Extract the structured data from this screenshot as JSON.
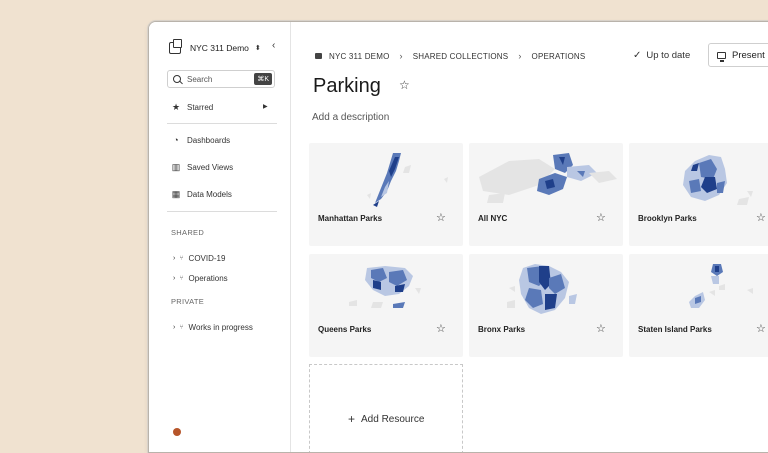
{
  "workspace": {
    "name": "NYC 311 Demo"
  },
  "sidebar": {
    "search_placeholder": "Search",
    "search_shortcut": "⌘K",
    "starred": "Starred",
    "nav": [
      {
        "label": "Dashboards",
        "icon": "gauge-icon"
      },
      {
        "label": "Saved Views",
        "icon": "bar-chart-icon"
      },
      {
        "label": "Data Models",
        "icon": "table-icon"
      }
    ],
    "shared_title": "SHARED",
    "shared_items": [
      "COVID-19",
      "Operations"
    ],
    "private_title": "PRIVATE",
    "private_items": [
      "Works in progress"
    ]
  },
  "breadcrumb": [
    "NYC 311 DEMO",
    "SHARED COLLECTIONS",
    "OPERATIONS"
  ],
  "status": "Up to date",
  "present_label": "Present",
  "page": {
    "title": "Parking",
    "description_placeholder": "Add a description"
  },
  "cards": [
    {
      "label": "Manhattan Parks"
    },
    {
      "label": "All NYC"
    },
    {
      "label": "Brooklyn Parks"
    },
    {
      "label": "Queens Parks"
    },
    {
      "label": "Bronx Parks"
    },
    {
      "label": "Staten Island Parks"
    }
  ],
  "add_resource": "Add Resource",
  "colors": {
    "map_dark": "#1f3f8a",
    "map_mid": "#5a79b8",
    "map_light": "#b9c7e3",
    "map_gray": "#e4e4e4",
    "card_bg": "#f5f5f5"
  }
}
